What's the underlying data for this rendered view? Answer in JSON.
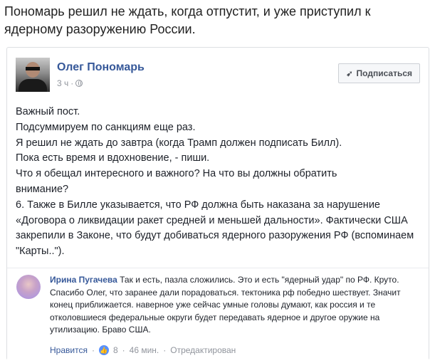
{
  "headline": "Пономарь решил не ждать, когда отпустит, и уже приступил к ядерному разоружению России.",
  "post": {
    "author": "Олег Пономарь",
    "time": "3 ч",
    "subscribe_label": "Подписаться",
    "body_lines": [
      "Важный пост.",
      "Подсуммируем по санкциям еще раз.",
      "Я решил не ждать до завтра (когда Трамп должен подписать Билл).",
      "Пока есть время и вдохновение, - пиши.",
      "Что я обещал интересного и важного? На что вы должны обратить",
      "внимание?"
    ],
    "point6": "6. Также в Билле указывается, что РФ должна быть наказана за нарушение «Договора о ликвидации ракет средней и меньшей дальности». Фактически США закрепили в Законе, что будут добиваться ядерного разоружения РФ (вспоминаем \"Карты..\")."
  },
  "comment": {
    "author": "Ирина Пугачева",
    "text": "Так и есть, пазла сложились. Это и есть \"ядерный удар\" по РФ. Круто. Спасибо Олег, что заранее дали порадоваться. тектоника рф победно шествует. Значит конец приближается. наверное уже сейчас умные головы думают, как россия и те отколовшиеся федеральные округи будет передавать ядерное и другое оружие на утилизацию. Браво США.",
    "like_label": "Нравится",
    "like_count": "8",
    "time": "46 мин.",
    "edited_label": "Отредактирован"
  },
  "icons": {
    "globe": "globe-icon",
    "rss": "rss-icon",
    "like": "like-icon"
  },
  "colors": {
    "link": "#365899",
    "muted": "#90949c",
    "like_blue": "#5890ff"
  }
}
